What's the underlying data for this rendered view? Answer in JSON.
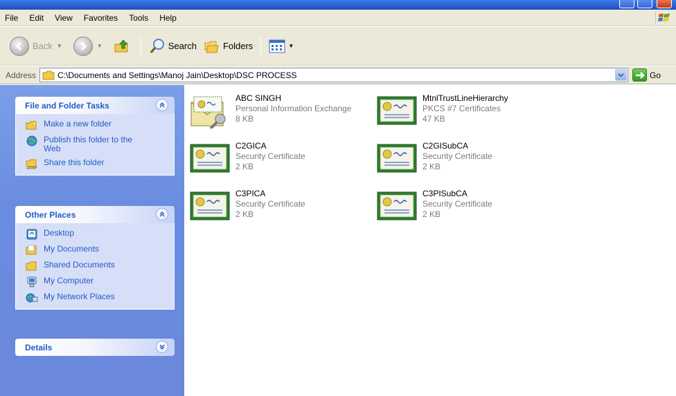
{
  "menu": {
    "items": [
      {
        "label": "File"
      },
      {
        "label": "Edit"
      },
      {
        "label": "View"
      },
      {
        "label": "Favorites"
      },
      {
        "label": "Tools"
      },
      {
        "label": "Help"
      }
    ]
  },
  "toolbar": {
    "back_label": "Back",
    "search_label": "Search",
    "folders_label": "Folders"
  },
  "address": {
    "label": "Address",
    "value": "C:\\Documents and Settings\\Manoj Jain\\Desktop\\DSC PROCESS",
    "go_label": "Go"
  },
  "tasks_panel": {
    "title": "File and Folder Tasks",
    "items": [
      {
        "label": "Make a new folder",
        "icon": "new-folder-icon"
      },
      {
        "label": "Publish this folder to the Web",
        "icon": "publish-web-icon"
      },
      {
        "label": "Share this folder",
        "icon": "share-folder-icon"
      }
    ]
  },
  "places_panel": {
    "title": "Other Places",
    "items": [
      {
        "label": "Desktop",
        "icon": "desktop-icon"
      },
      {
        "label": "My Documents",
        "icon": "my-documents-icon"
      },
      {
        "label": "Shared Documents",
        "icon": "shared-documents-icon"
      },
      {
        "label": "My Computer",
        "icon": "my-computer-icon"
      },
      {
        "label": "My Network Places",
        "icon": "network-places-icon"
      }
    ]
  },
  "details_panel": {
    "title": "Details"
  },
  "files": [
    {
      "name": "ABC SINGH",
      "type": "Personal Information Exchange",
      "size": "8 KB",
      "icon": "pfx-certificate-icon"
    },
    {
      "name": "MtnlTrustLineHierarchy",
      "type": "PKCS #7 Certificates",
      "size": "47 KB",
      "icon": "certificate-icon"
    },
    {
      "name": "C2GICA",
      "type": "Security Certificate",
      "size": "2 KB",
      "icon": "certificate-icon"
    },
    {
      "name": "C2GISubCA",
      "type": "Security Certificate",
      "size": "2 KB",
      "icon": "certificate-icon"
    },
    {
      "name": "C3PICA",
      "type": "Security Certificate",
      "size": "2 KB",
      "icon": "certificate-icon"
    },
    {
      "name": "C3PISubCA",
      "type": "Security Certificate",
      "size": "2 KB",
      "icon": "certificate-icon"
    }
  ],
  "colors": {
    "taskpane_bg": "#6a8ce0",
    "panel_title": "#215dc6",
    "link": "#215dc6",
    "menubar_bg": "#ece9d8"
  }
}
